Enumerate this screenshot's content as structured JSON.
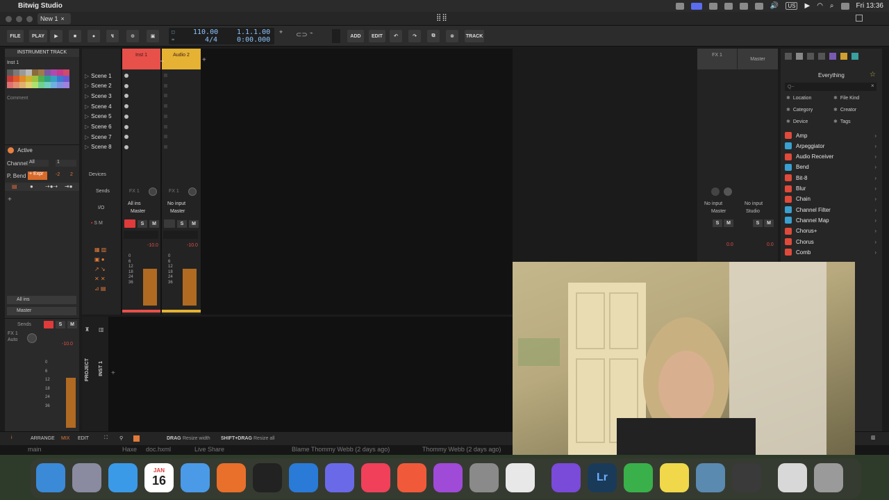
{
  "menubar": {
    "app_name": "Bitwig Studio",
    "clock": "Fri 13:36",
    "input_label": "US"
  },
  "window": {
    "tab_title": "New 1",
    "tab_close": "×"
  },
  "transport": {
    "file": "FILE",
    "play": "PLAY",
    "tempo": "110.00",
    "signature": "4/4",
    "position": "1.1.1.00",
    "time": "0:00.000",
    "add": "ADD",
    "edit": "EDIT",
    "track": "TRACK"
  },
  "inspector": {
    "header": "INSTRUMENT TRACK",
    "track_name": "Inst 1",
    "comment": "Comment",
    "active": "Active",
    "channel_label": "Channel",
    "channel_value": "All",
    "channel_num": "1",
    "pbend_label": "P. Bend",
    "pbend_mode": "+ Expr",
    "pbend_value": "-2",
    "pbend_range": "2",
    "input": "All ins",
    "output": "Master",
    "sends_label": "Sends",
    "send_fx": "FX 1",
    "send_mode": "Auto",
    "level": "-10.0",
    "palette": [
      "#5a5a5a",
      "#7a7a7a",
      "#9a9a9a",
      "#b9b9b9",
      "#8a6a3a",
      "#a07a4a",
      "#7a5aa0",
      "#b04ab0",
      "#c83a8a",
      "#d04a6a",
      "#c83a3a",
      "#e05a2a",
      "#e08a2a",
      "#d0b030",
      "#a0c040",
      "#50b050",
      "#30a08a",
      "#3aa0c0",
      "#3a7ad0",
      "#6a5ad0",
      "#e07070",
      "#e09070",
      "#e0b070",
      "#e0d070",
      "#b0e070",
      "#70d090",
      "#70d0c0",
      "#70b0e0",
      "#8090e0",
      "#a080e0"
    ]
  },
  "tracks": [
    {
      "name": "Inst 1",
      "color": "#e8504a",
      "sends": "FX 1",
      "input": "All ins",
      "output": "Master",
      "level": "-10.0"
    },
    {
      "name": "Audio 2",
      "color": "#e5b233",
      "sends": "FX 1",
      "input": "No input",
      "output": "Master",
      "level": "-10.0"
    }
  ],
  "fx_tracks": [
    {
      "name": "FX 1",
      "input": "No input",
      "output": "Master",
      "level": "0.0"
    },
    {
      "name": "Master",
      "input": "No input",
      "output": "Studio",
      "level": "0.0"
    }
  ],
  "scenes": [
    "Scene 1",
    "Scene 2",
    "Scene 3",
    "Scene 4",
    "Scene 5",
    "Scene 6",
    "Scene 7",
    "Scene 8"
  ],
  "mixer_labels": {
    "devices": "Devices",
    "sends": "Sends",
    "io": "I/O",
    "solo": "S",
    "mute": "M",
    "meter_scale": [
      "0",
      "6",
      "12",
      "18",
      "24",
      "36"
    ]
  },
  "browser": {
    "title": "Everything",
    "search_placeholder": "Q~",
    "filters": [
      "Location",
      "File Kind",
      "Category",
      "Creator",
      "Device",
      "Tags"
    ],
    "items": [
      {
        "name": "Amp",
        "color": "#e04a3a"
      },
      {
        "name": "Arpeggiator",
        "color": "#3aa0d0"
      },
      {
        "name": "Audio Receiver",
        "color": "#e04a3a"
      },
      {
        "name": "Bend",
        "color": "#3aa0d0"
      },
      {
        "name": "Bit-8",
        "color": "#e04a3a"
      },
      {
        "name": "Blur",
        "color": "#e04a3a"
      },
      {
        "name": "Chain",
        "color": "#e04a3a"
      },
      {
        "name": "Channel Filter",
        "color": "#3aa0d0"
      },
      {
        "name": "Channel Map",
        "color": "#3aa0d0"
      },
      {
        "name": "Chorus+",
        "color": "#e04a3a"
      },
      {
        "name": "Chorus",
        "color": "#e04a3a"
      },
      {
        "name": "Comb",
        "color": "#e04a3a"
      }
    ]
  },
  "bottom_panel": {
    "project_label": "PROJECT",
    "track_label": "INST 1"
  },
  "footer": {
    "arrange": "ARRANGE",
    "mix": "MIX",
    "edit": "EDIT",
    "drag_key": "DRAG",
    "drag_action": "Resize width",
    "shift_drag_key": "SHIFT+DRAG",
    "shift_drag_action": "Resize all"
  },
  "behind_window": {
    "branch": "main",
    "file1": "Haxe",
    "file2": "doc.hxml",
    "live_share": "Live Share",
    "blame1": "Blame Thommy Webb (2 days ago)",
    "blame2": "Thommy Webb (2 days ago)"
  },
  "dock": {
    "calendar_month": "JAN",
    "calendar_day": "16",
    "apps": [
      {
        "name": "finder",
        "color": "#3a8ad8"
      },
      {
        "name": "launchpad",
        "color": "#8a8aa0"
      },
      {
        "name": "app-store",
        "color": "#3a9ae8"
      },
      {
        "name": "calendar",
        "color": "#ffffff"
      },
      {
        "name": "mail",
        "color": "#4a9ae8"
      },
      {
        "name": "firefox",
        "color": "#e8702a"
      },
      {
        "name": "terminal",
        "color": "#222222"
      },
      {
        "name": "vscode",
        "color": "#2a7ad8"
      },
      {
        "name": "wave",
        "color": "#6a6ae8"
      },
      {
        "name": "music",
        "color": "#f0405a"
      },
      {
        "name": "calculator-grid",
        "color": "#f05a3a"
      },
      {
        "name": "podcasts",
        "color": "#a04ad8"
      },
      {
        "name": "system-settings",
        "color": "#8a8a8a"
      },
      {
        "name": "preview",
        "color": "#e8e8e8"
      },
      {
        "name": "obsidian",
        "color": "#7a4ad8"
      },
      {
        "name": "lightroom",
        "color": "#1a3a5a"
      },
      {
        "name": "numbers",
        "color": "#3ab04a"
      },
      {
        "name": "notes",
        "color": "#f0d84a"
      },
      {
        "name": "screenshot",
        "color": "#5a8ab0"
      },
      {
        "name": "bitwig",
        "color": "#3a3a3a"
      },
      {
        "name": "documents",
        "color": "#d8d8d8"
      },
      {
        "name": "trash",
        "color": "#9a9a9a"
      }
    ],
    "lr_label": "Lr"
  }
}
